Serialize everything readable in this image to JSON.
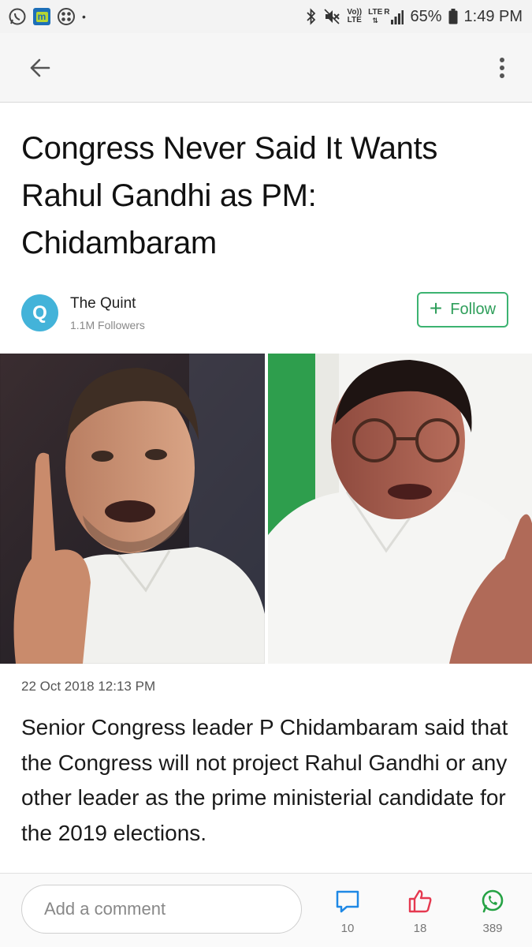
{
  "status_bar": {
    "left_icons": [
      "whatsapp-icon",
      "m-app-icon",
      "grid-app-icon",
      "notification-dot-icon"
    ],
    "m_app_letter": "m",
    "dot": "•",
    "volte_top": "Vo))",
    "volte_bottom": "LTE",
    "lte_top": "LTE",
    "lte_r": "R",
    "battery_percent": "65%",
    "time": "1:49 PM"
  },
  "app_bar": {
    "back_icon": "arrow-left-icon",
    "more_icon": "more-vertical-icon"
  },
  "article": {
    "headline": "Congress Never Said It Wants Rahul Gandhi as PM: Chidambaram",
    "publisher": {
      "logo_letter": "Q",
      "name": "The Quint",
      "followers": "1.1M Followers",
      "logo_color": "#43b3d9"
    },
    "follow_button": {
      "plus": "+",
      "label": "Follow",
      "color": "#3cb371"
    },
    "images": [
      "rahul-gandhi-photo",
      "chidambaram-photo"
    ],
    "timestamp": "22 Oct 2018 12:13 PM",
    "summary": "Senior Congress leader P Chidambaram said that the Congress will not project Rahul Gandhi or any other leader as the prime ministerial candidate for the 2019 elections."
  },
  "bottom_bar": {
    "comment_placeholder": "Add a comment",
    "actions": [
      {
        "icon": "comment-icon",
        "count": "10",
        "color": "#1e88e5"
      },
      {
        "icon": "like-icon",
        "count": "18",
        "color": "#e53950"
      },
      {
        "icon": "whatsapp-share-icon",
        "count": "389",
        "color": "#25a244"
      }
    ]
  }
}
